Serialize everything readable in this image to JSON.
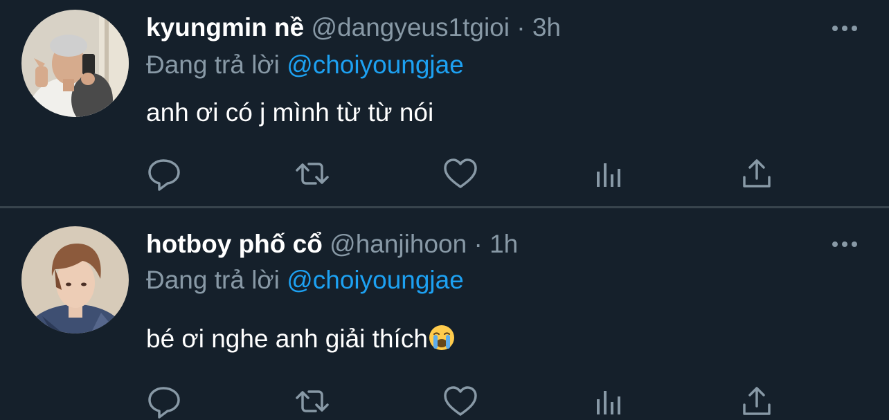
{
  "colors": {
    "background": "#15202b",
    "divider": "#38444d",
    "secondary_text": "#8899a6",
    "mention": "#1da1f2",
    "primary_text": "#ffffff"
  },
  "tweets": [
    {
      "display_name": "kyungmin nề",
      "handle": "@dangyeus1tgioi",
      "separator": "·",
      "time": "3h",
      "reply_prefix": "Đang trả lời",
      "reply_to": "@choiyoungjae",
      "text": "anh ơi có j mình từ từ nói",
      "icons": [
        "more-icon",
        "reply-icon",
        "retweet-icon",
        "like-icon",
        "analytics-icon",
        "share-icon"
      ]
    },
    {
      "display_name": "hotboy phố cổ",
      "handle": "@hanjihoon",
      "separator": "·",
      "time": "1h",
      "reply_prefix": "Đang trả lời",
      "reply_to": "@choiyoungjae",
      "text": "bé ơi nghe anh giải thích",
      "emoji": "loudly-crying-face-emoji",
      "icons": [
        "more-icon",
        "reply-icon",
        "retweet-icon",
        "like-icon",
        "analytics-icon",
        "share-icon"
      ]
    }
  ]
}
